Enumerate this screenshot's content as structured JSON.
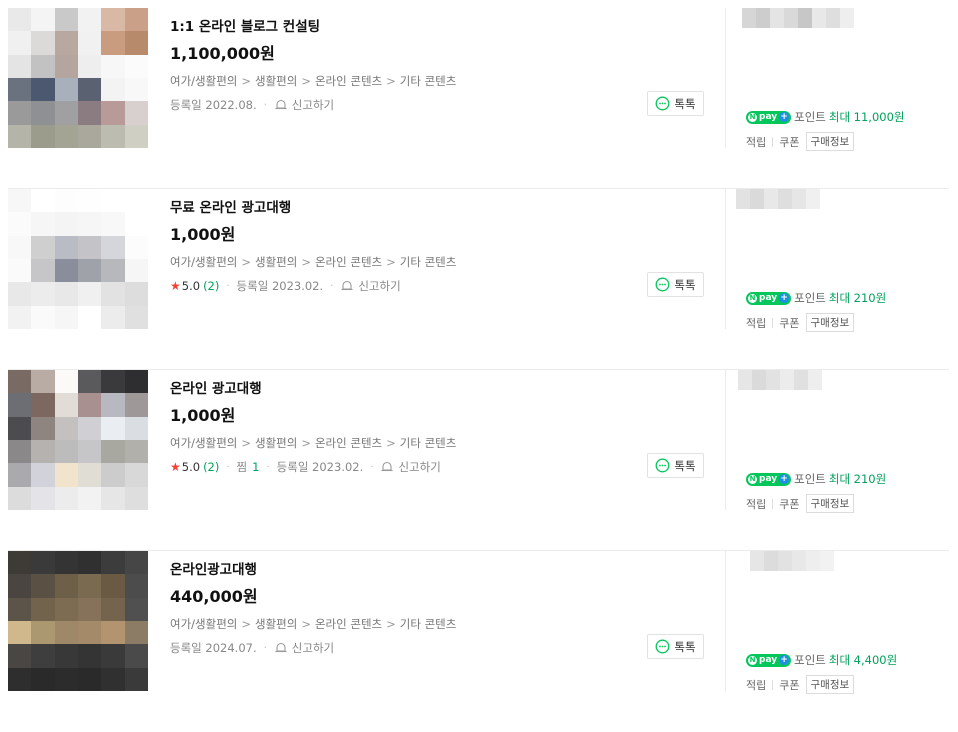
{
  "products": [
    {
      "title": "1:1 온라인 블로그 컨설팅",
      "price": "1,100,000원",
      "category": [
        "여가/생활편의",
        "생활편의",
        "온라인 콘텐츠",
        "기타 콘텐츠"
      ],
      "rating": null,
      "review_count": null,
      "zzim_label": null,
      "zzim_count": null,
      "registered": "등록일 2022.08.",
      "report_label": "신고하기",
      "talk_label": "톡톡",
      "point_label": "포인트",
      "point_max": "최대 11,000원",
      "benefit_1": "적립",
      "benefit_2": "쿠폰",
      "benefit_3": "구매정보"
    },
    {
      "title": "무료 온라인 광고대행",
      "price": "1,000원",
      "category": [
        "여가/생활편의",
        "생활편의",
        "온라인 콘텐츠",
        "기타 콘텐츠"
      ],
      "rating": "5.0",
      "review_count": "(2)",
      "zzim_label": null,
      "zzim_count": null,
      "registered": "등록일 2023.02.",
      "report_label": "신고하기",
      "talk_label": "톡톡",
      "point_label": "포인트",
      "point_max": "최대 210원",
      "benefit_1": "적립",
      "benefit_2": "쿠폰",
      "benefit_3": "구매정보"
    },
    {
      "title": "온라인 광고대행",
      "price": "1,000원",
      "category": [
        "여가/생활편의",
        "생활편의",
        "온라인 콘텐츠",
        "기타 콘텐츠"
      ],
      "rating": "5.0",
      "review_count": "(2)",
      "zzim_label": "찜",
      "zzim_count": "1",
      "registered": "등록일 2023.02.",
      "report_label": "신고하기",
      "talk_label": "톡톡",
      "point_label": "포인트",
      "point_max": "최대 210원",
      "benefit_1": "적립",
      "benefit_2": "쿠폰",
      "benefit_3": "구매정보"
    },
    {
      "title": "온라인광고대행",
      "price": "440,000원",
      "category": [
        "여가/생활편의",
        "생활편의",
        "온라인 콘텐츠",
        "기타 콘텐츠"
      ],
      "rating": null,
      "review_count": null,
      "zzim_label": null,
      "zzim_count": null,
      "registered": "등록일 2024.07.",
      "report_label": "신고하기",
      "talk_label": "톡톡",
      "point_label": "포인트",
      "point_max": "최대 4,400원",
      "benefit_1": "적립",
      "benefit_2": "쿠폰",
      "benefit_3": "구매정보"
    }
  ],
  "colors": {
    "brand_green": "#03c75a",
    "point_green": "#00a15a",
    "star_red": "#f44336",
    "npay_plus_blue": "#1f8ee6"
  }
}
